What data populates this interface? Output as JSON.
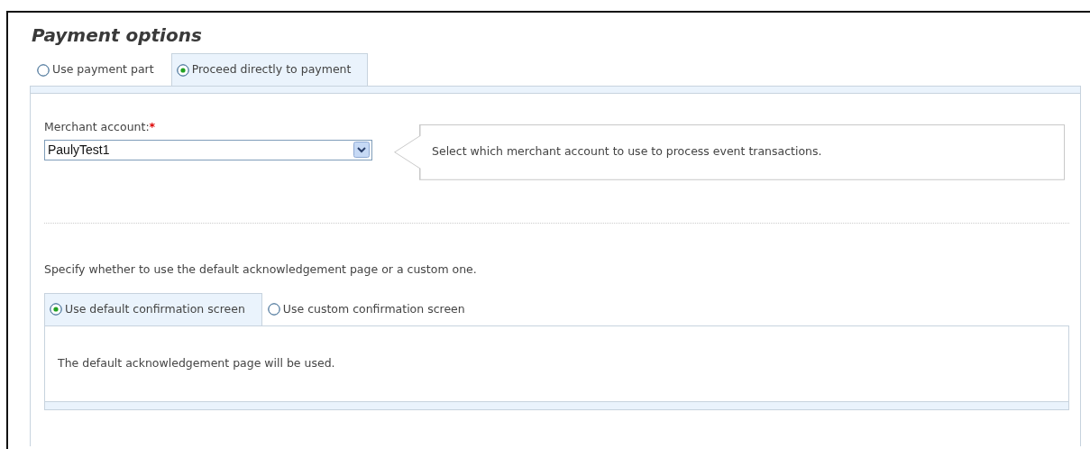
{
  "title": "Payment options",
  "payment_tabs": [
    {
      "label": "Use payment part",
      "selected": false
    },
    {
      "label": "Proceed directly to payment",
      "selected": true
    }
  ],
  "merchant_account": {
    "label": "Merchant account:",
    "required_mark": "*",
    "value": "PaulyTest1"
  },
  "hint": "Select which merchant account to use to process event transactions.",
  "acknowledgement": {
    "instruction": "Specify whether to use the default acknowledgement page or a custom one.",
    "tabs": [
      {
        "label": "Use default confirmation screen",
        "selected": true
      },
      {
        "label": "Use custom confirmation screen",
        "selected": false
      }
    ],
    "content": "The default acknowledgement page will be used."
  }
}
